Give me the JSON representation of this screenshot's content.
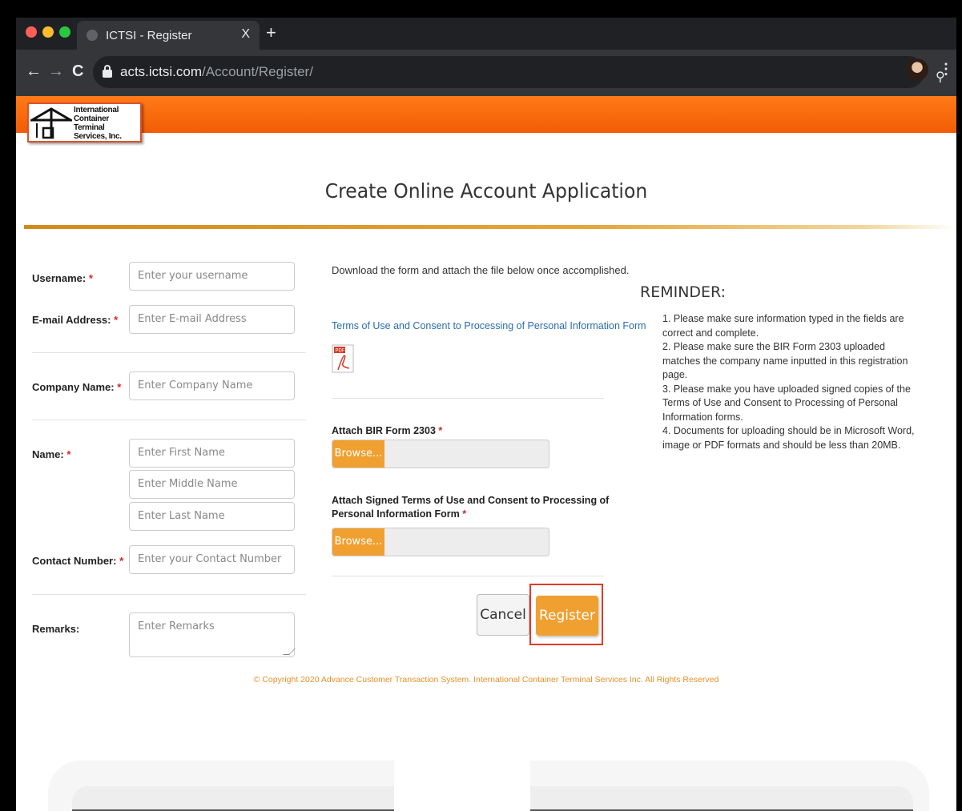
{
  "browser": {
    "tab_title": "ICTSI - Register",
    "tab_close": "X",
    "new_tab": "+",
    "back": "←",
    "forward": "→",
    "reload": "C",
    "url_host": "acts.ictsi.com",
    "url_path": "/Account/Register/",
    "zoom_glyph": "⚲",
    "star_glyph": "☆",
    "menu_glyph": "⋮"
  },
  "logo": {
    "line1": "International",
    "line2": "Container Terminal",
    "line3": "Services, Inc."
  },
  "page_title": "Create Online Account Application",
  "form": {
    "username_label": "Username:",
    "username_placeholder": "Enter your username",
    "email_label": "E-mail Address:",
    "email_placeholder": "Enter E-mail Address",
    "company_label": "Company Name:",
    "company_placeholder": "Enter Company Name",
    "name_label": "Name:",
    "first_name_placeholder": "Enter First Name",
    "middle_name_placeholder": "Enter Middle Name",
    "last_name_placeholder": "Enter Last Name",
    "contact_label": "Contact Number:",
    "contact_placeholder": "Enter your Contact Number",
    "remarks_label": "Remarks:",
    "remarks_placeholder": "Enter Remarks",
    "required_mark": " *"
  },
  "downloads": {
    "instruction": "Download the form and attach the file below once accomplished.",
    "terms_link": "Terms of Use and Consent to Processing of Personal Information Form",
    "pdf_icon_text": "PDF"
  },
  "attachments": {
    "bir_label": "Attach BIR Form 2303",
    "terms_label": "Attach Signed Terms of Use and Consent to Processing of Personal Information Form",
    "browse_label": "Browse..."
  },
  "actions": {
    "cancel": "Cancel",
    "register": "Register"
  },
  "reminder": {
    "title": "REMINDER:",
    "items": [
      "1. Please make sure information typed in the fields are correct and complete.",
      "2. Please make sure the BIR Form 2303 uploaded matches the company name inputted in this registration page.",
      "3. Please make you have uploaded signed copies of the Terms of Use and Consent to Processing of Personal Information forms.",
      "4. Documents for uploading should be in Microsoft Word, image or PDF formats and should be less than 20MB."
    ]
  },
  "footer": "© Copyright 2020 Advance Customer Transaction System. International Container Terminal Services Inc. All Rights Reserved",
  "colors": {
    "brand_orange": "#f25c05",
    "button_orange": "#f0a030",
    "link_blue": "#2b6cb0",
    "highlight_red": "#e03a2a"
  }
}
